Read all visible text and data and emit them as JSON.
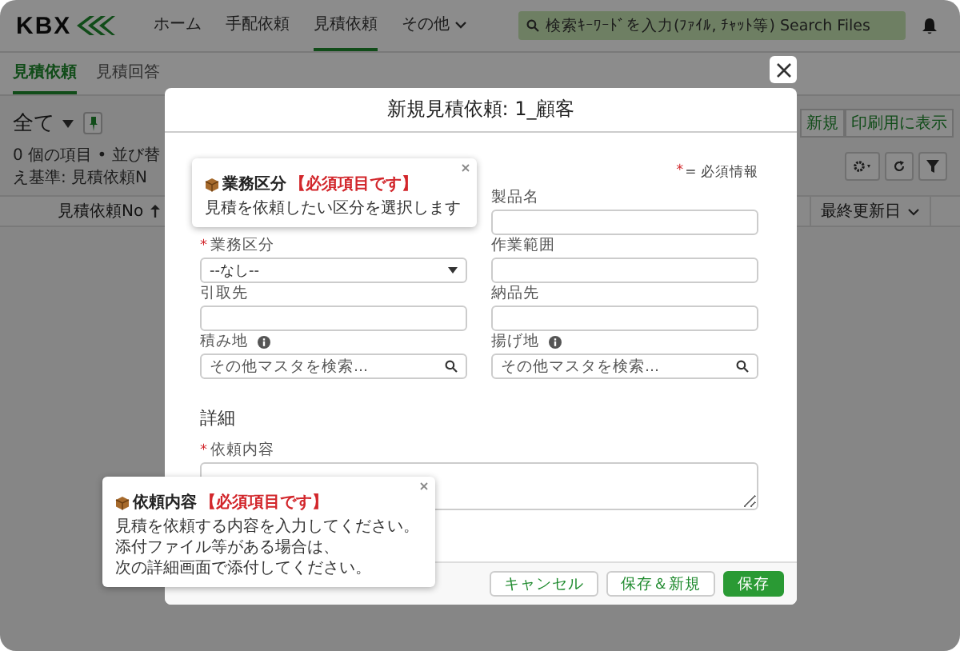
{
  "nav": {
    "logo": "KBX",
    "items": [
      {
        "label": "ホーム",
        "selected": false,
        "dropdown": false
      },
      {
        "label": "手配依頼",
        "selected": false,
        "dropdown": false
      },
      {
        "label": "見積依頼",
        "selected": true,
        "dropdown": false
      },
      {
        "label": "その他",
        "selected": false,
        "dropdown": true
      }
    ],
    "search": {
      "placeholder": "検索ｷｰﾜｰﾄﾞを入力(ﾌｧｲﾙ, ﾁｬｯﾄ等) Search Files"
    }
  },
  "subtabs": [
    {
      "label": "見積依頼",
      "selected": true
    },
    {
      "label": "見積回答",
      "selected": false
    }
  ],
  "list_view": {
    "name": "全て",
    "actions": [
      "新規",
      "印刷用に表示"
    ],
    "info": "0 個の項目 • 並び替え基準: 見積依頼N",
    "columns": [
      {
        "label": "見積依頼No",
        "sorted": true
      },
      {
        "label": "最終更新日",
        "sorted": false
      }
    ]
  },
  "modal": {
    "title": "新規見積依頼: 1_顧客",
    "required_mark": "*",
    "required_legend": "= 必須情報",
    "left_fields": [
      {
        "label": "業務区分",
        "kind": "select",
        "required": true,
        "info": false,
        "value": "--なし--"
      },
      {
        "label": "引取先",
        "kind": "text",
        "required": false,
        "info": false
      },
      {
        "label": "積み地",
        "kind": "lookup",
        "required": false,
        "info": true,
        "placeholder": "その他マスタを検索..."
      }
    ],
    "right_fields": [
      {
        "label": "製品名",
        "kind": "text",
        "required": false,
        "info": false
      },
      {
        "label": "作業範囲",
        "kind": "text",
        "required": false,
        "info": false
      },
      {
        "label": "納品先",
        "kind": "text",
        "required": false,
        "info": false
      },
      {
        "label": "揚げ地",
        "kind": "lookup",
        "required": false,
        "info": true,
        "placeholder": "その他マスタを検索..."
      }
    ],
    "section": "詳細",
    "detail_field": {
      "label": "依頼内容",
      "kind": "textarea",
      "required": true,
      "info": false
    },
    "buttons": [
      {
        "label": "キャンセル",
        "primary": false
      },
      {
        "label": "保存＆新規",
        "primary": false
      },
      {
        "label": "保存",
        "primary": true
      }
    ]
  },
  "tooltips": [
    {
      "title": "業務区分",
      "badge": "【必須項目です】",
      "lines": [
        "見積を依頼したい区分を選択します"
      ]
    },
    {
      "title": "依頼内容",
      "badge": "【必須項目です】",
      "lines": [
        "見積を依頼する内容を入力してください。",
        "添付ファイル等がある場合は、",
        "次の詳細画面で添付してください。"
      ]
    }
  ]
}
